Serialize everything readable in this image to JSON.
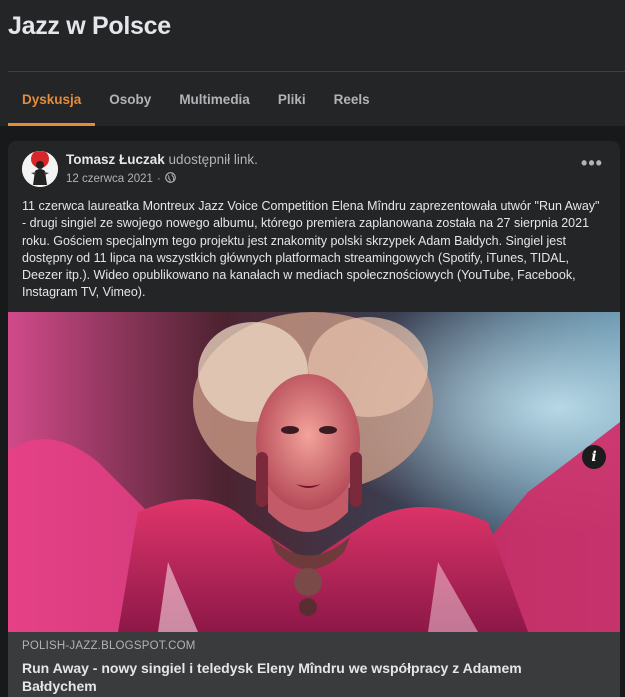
{
  "group": {
    "title": "Jazz w Polsce"
  },
  "tabs": [
    {
      "label": "Dyskusja",
      "active": true
    },
    {
      "label": "Osoby",
      "active": false
    },
    {
      "label": "Multimedia",
      "active": false
    },
    {
      "label": "Pliki",
      "active": false
    },
    {
      "label": "Reels",
      "active": false
    }
  ],
  "post": {
    "author": "Tomasz Łuczak",
    "action": "udostępnił link.",
    "date": "12 czerwca 2021",
    "separator": "·",
    "privacy_icon": "globe-icon",
    "more_label": "•••",
    "text": "11 czerwca laureatka Montreux Jazz Voice Competition Elena Mîndru zaprezentowała utwór \"Run Away\" - drugi singiel ze swojego nowego albumu, którego premiera zaplanowana została na 27 sierpnia 2021 roku. Gościem specjalnym tego projektu jest znakomity polski skrzypek Adam Bałdych. Singiel jest dostępny od 11 lipca na wszystkich głównych platformach streamingowych (Spotify, iTunes, TIDAL, Deezer itp.). Wideo opublikowano na kanałach w mediach społecznościowych (YouTube, Facebook, Instagram TV, Vimeo).",
    "link": {
      "domain": "POLISH-JAZZ.BLOGSPOT.COM",
      "title": "Run Away - nowy singiel i teledysk Eleny Mîndru we współpracy z Adamem Bałdychem",
      "info_label": "i"
    }
  },
  "colors": {
    "background": "#18191a",
    "surface": "#242526",
    "accent": "#e58c3a",
    "link_footer": "#3a3b3c"
  }
}
